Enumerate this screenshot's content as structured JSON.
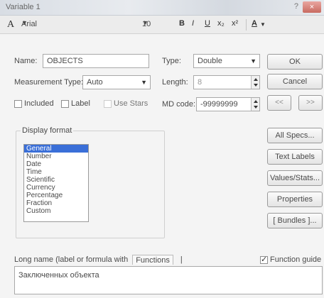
{
  "window": {
    "title": "Variable 1",
    "help": "?",
    "close": "×"
  },
  "toolbar": {
    "font_glyph": "A",
    "font_name": "Arial",
    "font_size": "10",
    "bold": "B",
    "italic": "I",
    "underline": "U",
    "subscript": "x₂",
    "superscript": "x²",
    "font_color": "A"
  },
  "form": {
    "name_label": "Name:",
    "name_value": "OBJECTS",
    "type_label": "Type:",
    "type_value": "Double",
    "measurement_label": "Measurement Type:",
    "measurement_value": "Auto",
    "length_label": "Length:",
    "length_value": "8",
    "included_label": "Included",
    "label_label": "Label",
    "use_stars_label": "Use Stars",
    "md_code_label": "MD code:",
    "md_code_value": "-99999999"
  },
  "buttons": {
    "ok": "OK",
    "cancel": "Cancel",
    "prev": "<<",
    "next": ">>",
    "all_specs": "All Specs...",
    "text_labels": "Text Labels",
    "values_stats": "Values/Stats...",
    "properties": "Properties",
    "bundles": "[ Bundles ]..."
  },
  "display_format": {
    "legend": "Display format",
    "options": [
      "General",
      "Number",
      "Date",
      "Time",
      "Scientific",
      "Currency",
      "Percentage",
      "Fraction",
      "Custom"
    ],
    "selected_index": 0
  },
  "bottom": {
    "long_name_tab": "Long name (label or formula with",
    "functions_tab": "Functions",
    "more_tab": "|",
    "function_guide_label": "Function guide",
    "function_guide_checked": true,
    "long_name_value": "Заключенных объекта"
  }
}
